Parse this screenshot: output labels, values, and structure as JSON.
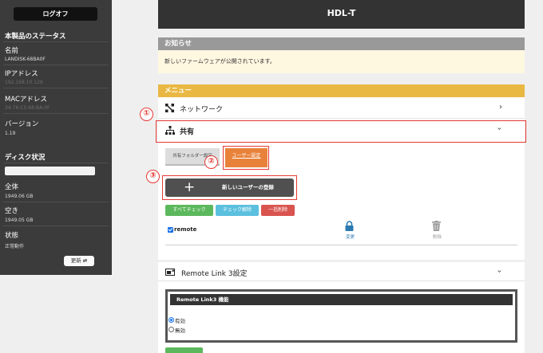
{
  "sidebar": {
    "logoff_label": "ログオフ",
    "status_heading": "本製品のステータス",
    "name_label": "名前",
    "name_value": "LANDISK-68BA0F",
    "ip_label": "IPアドレス",
    "ip_value": "192.168.10.129",
    "mac_label": "MACアドレス",
    "mac_value": "34:76:C5:68:BA:0F",
    "version_label": "バージョン",
    "version_value": "1.19",
    "disk_heading": "ディスク状況",
    "total_label": "全体",
    "total_value": "1949.06 GB",
    "free_label": "空き",
    "free_value": "1949.05 GB",
    "state_label": "状態",
    "state_value": "正常動作",
    "refresh_label": "更新"
  },
  "header": {
    "title": "HDL-T"
  },
  "notice": {
    "heading": "お知らせ",
    "message": "新しいファームウェアが公開されています。"
  },
  "menu": {
    "heading": "メニュー",
    "network_label": "ネットワーク",
    "share_label": "共有",
    "tabs": [
      "共有フォルダー設定",
      "ユーザー設定"
    ],
    "new_user_label": "新しいユーザーの登録",
    "check_all_label": "すべてチェック",
    "uncheck_label": "チェック解除",
    "bulk_delete_label": "一括削除",
    "user_name": "remote",
    "change_label": "変更",
    "delete_label": "削除"
  },
  "remote": {
    "title": "Remote Link 3設定",
    "box_heading": "Remote Link3 機能",
    "options": [
      "有効",
      "無効"
    ],
    "selected": "有効"
  },
  "annotations": [
    "①",
    "②",
    "③"
  ],
  "colors": {
    "accent_gold": "#e9b843",
    "tab_orange": "#e8823a",
    "check_green": "#5cb85c",
    "uncheck_blue": "#5bc0de",
    "delete_red": "#d9534f",
    "change_blue": "#2a7ab0",
    "annotation_red": "#e53935"
  }
}
